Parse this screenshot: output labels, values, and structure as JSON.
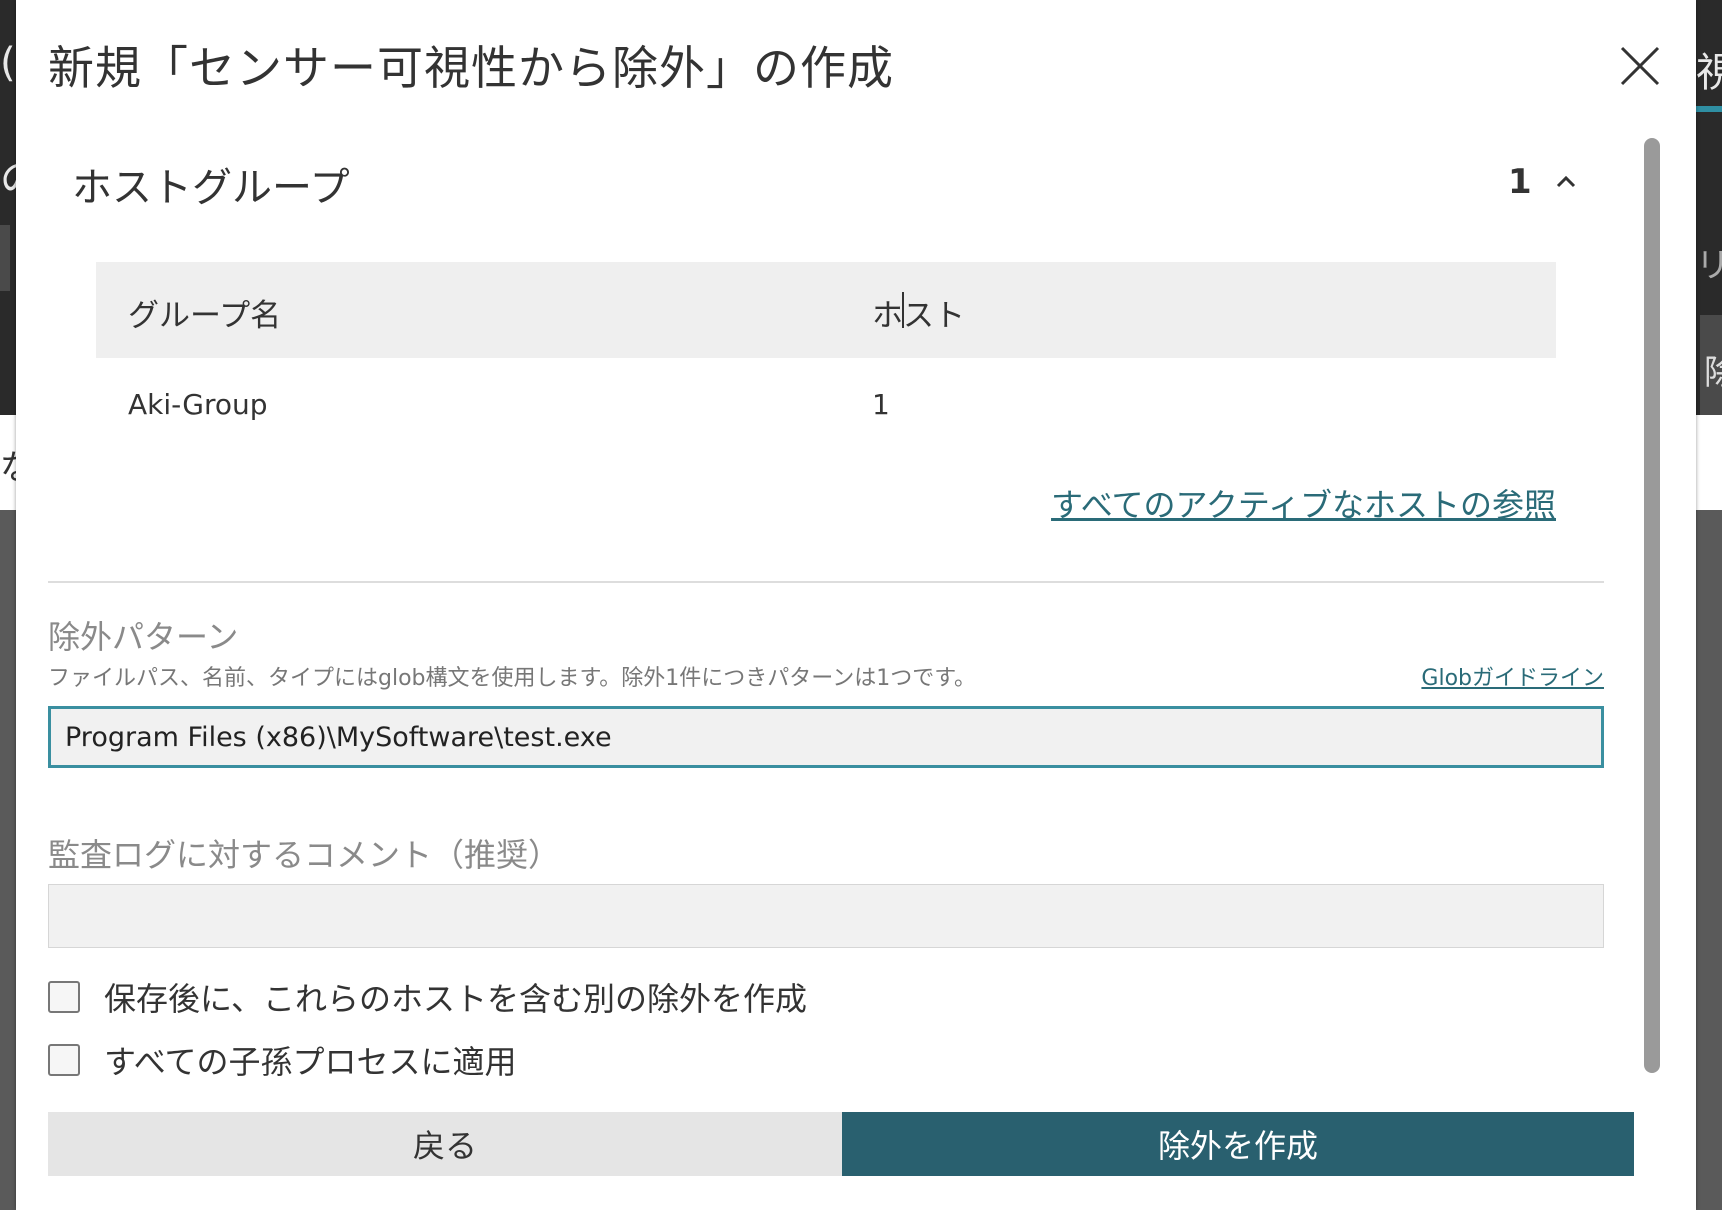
{
  "modal": {
    "title": "新規「センサー可視性から除外」の作成"
  },
  "host_groups": {
    "section_title": "ホストグループ",
    "count": "1",
    "table": {
      "columns": [
        "グループ名",
        "ホスト"
      ],
      "rows": [
        [
          "Aki-Group",
          "1"
        ]
      ]
    },
    "view_all_link": "すべてのアクティブなホストの参照"
  },
  "exclusion_pattern": {
    "label": "除外パターン",
    "help": "ファイルパス、名前、タイプにはglob構文を使用します。除外1件につきパターンは1つです。",
    "guide_link": "Globガイドライン",
    "value": "Program Files (x86)\\MySoftware\\test.exe"
  },
  "audit_comment": {
    "label": "監査ログに対するコメント（推奨）",
    "value": ""
  },
  "options": [
    {
      "label": "保存後に、これらのホストを含む別の除外を作成",
      "checked": false
    },
    {
      "label": "すべての子孫プロセスに適用",
      "checked": false
    }
  ],
  "buttons": {
    "back": "戻る",
    "create": "除外を作成"
  },
  "background": {
    "left_fragments": [
      "(",
      "の",
      "な"
    ],
    "right_fragments": [
      "視性",
      "リフ",
      "除"
    ]
  },
  "colors": {
    "accent": "#29606f",
    "link": "#2a6b78",
    "input_focus_border": "#3a8fa0"
  }
}
